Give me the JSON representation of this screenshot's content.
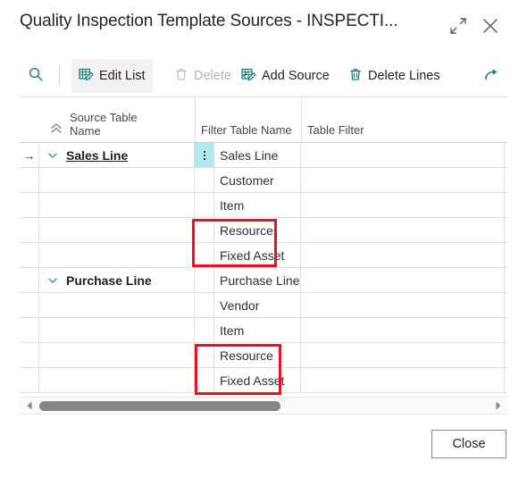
{
  "window": {
    "title": "Quality Inspection Template Sources - INSPECTI...",
    "expand_icon": "expand-icon",
    "close_icon": "close-icon"
  },
  "toolbar": {
    "search_icon": "search-icon",
    "edit_list_label": "Edit List",
    "edit_list_icon": "edit-list-icon",
    "delete_label": "Delete",
    "delete_icon": "trash-icon",
    "add_source_label": "Add Source",
    "add_source_icon": "add-source-icon",
    "delete_lines_label": "Delete Lines",
    "delete_lines_icon": "trash-lines-icon",
    "share_icon": "share-icon"
  },
  "grid": {
    "collapse_all_icon": "double-chevron-up-icon",
    "headers": {
      "source_table_name": "Source Table\nName",
      "source_table_name_line1": "Source Table",
      "source_table_name_line2": "Name",
      "filter_table_name": "Filter Table Name",
      "table_filter": "Table Filter"
    },
    "rows": [
      {
        "indicator": "→",
        "expander": "chevron-down-icon",
        "source_table_name": "Sales Line",
        "bold": true,
        "underline": true,
        "selected": true,
        "options_icon": "vertical-ellipsis-icon",
        "filter_table_name": "Sales Line",
        "table_filter": ""
      },
      {
        "indicator": "",
        "expander": "",
        "source_table_name": "",
        "bold": false,
        "underline": false,
        "selected": false,
        "options_icon": "",
        "filter_table_name": "Customer",
        "table_filter": ""
      },
      {
        "indicator": "",
        "expander": "",
        "source_table_name": "",
        "bold": false,
        "underline": false,
        "selected": false,
        "options_icon": "",
        "filter_table_name": "Item",
        "table_filter": ""
      },
      {
        "indicator": "",
        "expander": "",
        "source_table_name": "",
        "bold": false,
        "underline": false,
        "selected": false,
        "options_icon": "",
        "filter_table_name": "Resource",
        "table_filter": ""
      },
      {
        "indicator": "",
        "expander": "",
        "source_table_name": "",
        "bold": false,
        "underline": false,
        "selected": false,
        "options_icon": "",
        "filter_table_name": "Fixed Asset",
        "table_filter": ""
      },
      {
        "indicator": "",
        "expander": "chevron-down-icon",
        "source_table_name": "Purchase Line",
        "bold": true,
        "underline": false,
        "selected": false,
        "options_icon": "",
        "filter_table_name": "Purchase Line",
        "table_filter": ""
      },
      {
        "indicator": "",
        "expander": "",
        "source_table_name": "",
        "bold": false,
        "underline": false,
        "selected": false,
        "options_icon": "",
        "filter_table_name": "Vendor",
        "table_filter": ""
      },
      {
        "indicator": "",
        "expander": "",
        "source_table_name": "",
        "bold": false,
        "underline": false,
        "selected": false,
        "options_icon": "",
        "filter_table_name": "Item",
        "table_filter": ""
      },
      {
        "indicator": "",
        "expander": "",
        "source_table_name": "",
        "bold": false,
        "underline": false,
        "selected": false,
        "options_icon": "",
        "filter_table_name": "Resource",
        "table_filter": ""
      },
      {
        "indicator": "",
        "expander": "",
        "source_table_name": "",
        "bold": false,
        "underline": false,
        "selected": false,
        "options_icon": "",
        "filter_table_name": "Fixed Asset",
        "table_filter": ""
      }
    ]
  },
  "annotations": [
    {
      "label": "highlight-resource-fixed-asset-sales",
      "color": "#e81123"
    },
    {
      "label": "highlight-resource-fixed-asset-purchase",
      "color": "#e81123"
    }
  ],
  "scrollbar": {
    "left_arrow_icon": "scroll-left-arrow-icon",
    "right_arrow_icon": "scroll-right-arrow-icon"
  },
  "footer": {
    "close_label": "Close"
  },
  "colors": {
    "accent_teal": "#1a7f85",
    "selection_cell": "#b3e8ec",
    "annotation_red": "#e81123",
    "disabled_text": "#b6b4b2"
  }
}
